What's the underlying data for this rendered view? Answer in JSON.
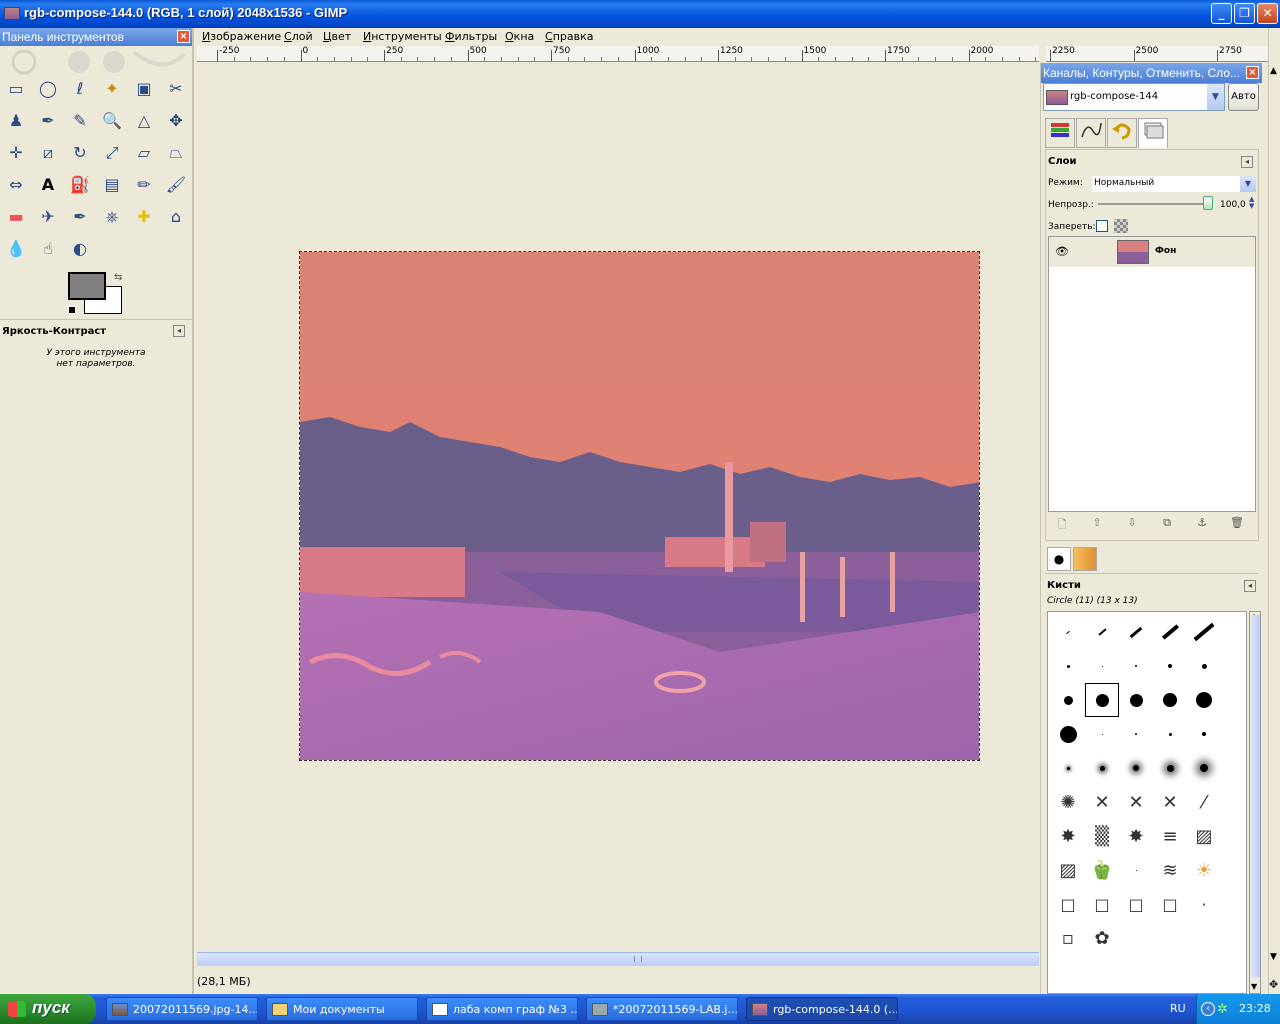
{
  "window": {
    "title": "rgb-compose-144.0 (RGB, 1 слой) 2048x1536 - GIMP",
    "minimize": "_",
    "maximize": "❐",
    "close": "✕"
  },
  "menubar": [
    "Изображение",
    "Слой",
    "Цвет",
    "Инструменты",
    "Фильтры",
    "Окна",
    "Справка"
  ],
  "toolbox": {
    "title": "Панель инструментов",
    "tools": [
      "rect-select",
      "ellipse-select",
      "free-select",
      "fuzzy-select",
      "by-color-select",
      "scissors",
      "foreground-select",
      "paths",
      "color-picker",
      "zoom",
      "measure",
      "move",
      "align",
      "crop",
      "rotate",
      "scale",
      "shear",
      "perspective",
      "flip",
      "text",
      "bucket-fill",
      "blend",
      "pencil",
      "paintbrush",
      "eraser",
      "airbrush",
      "ink",
      "clone",
      "heal",
      "perspective-clone",
      "blur",
      "smudge",
      "dodge-burn"
    ],
    "tool_options_title": "Яркость-Контраст",
    "tool_options_text_1": "У этого инструмента",
    "tool_options_text_2": "нет параметров.",
    "fg_color": "#808080",
    "bg_color": "#ffffff"
  },
  "ruler": {
    "labels": [
      "-250",
      "0",
      "250",
      "500",
      "750",
      "1000",
      "1250",
      "1500",
      "1750",
      "2000",
      "2250",
      "2500",
      "2750"
    ]
  },
  "status": {
    "memory": "(28,1 МБ)"
  },
  "dock": {
    "title": "Каналы, Контуры, Отменить, Сло...",
    "image_name": "rgb-compose-144",
    "auto_button": "Авто",
    "layers": {
      "title": "Слои",
      "mode_label": "Режим:",
      "mode_value": "Нормальный",
      "opacity_label": "Непрозр.:",
      "opacity_value": "100,0",
      "opacity_level": 1.0,
      "lock_label": "Запереть:",
      "items": [
        {
          "name": "Фон",
          "visible": true
        }
      ]
    },
    "brushes": {
      "title": "Кисти",
      "selected": "Circle (11) (13 x 13)"
    }
  },
  "taskbar": {
    "start": "пуск",
    "tasks": [
      {
        "label": "20072011569.jpg-14..."
      },
      {
        "label": "Мои документы"
      },
      {
        "label": "лаба комп граф №3 ..."
      },
      {
        "label": "*20072011569-LAB.j..."
      },
      {
        "label": "rgb-compose-144.0 (..."
      }
    ],
    "lang": "RU",
    "clock": "23:28"
  },
  "colors": {
    "sky": "#e08078",
    "trees": "#6a5f8a",
    "ground": "#a66aa8",
    "accent": "#245edb"
  }
}
